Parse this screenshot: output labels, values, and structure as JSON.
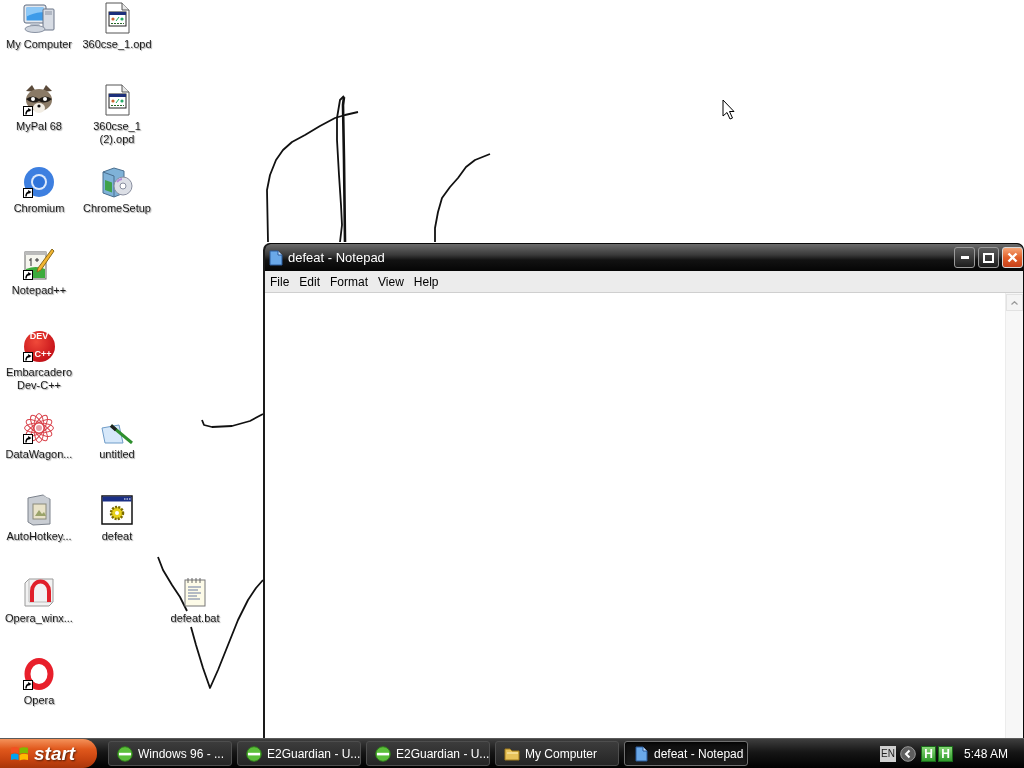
{
  "desktop": {
    "icons": [
      {
        "label": "My Computer",
        "kind": "computer",
        "shortcut": false
      },
      {
        "label": "360cse_1.opd",
        "kind": "opd",
        "shortcut": false
      },
      {
        "label": "MyPal 68",
        "kind": "raccoon",
        "shortcut": true
      },
      {
        "label": "360cse_1 (2).opd",
        "kind": "opd",
        "shortcut": false
      },
      {
        "label": "Chromium",
        "kind": "chromium",
        "shortcut": true
      },
      {
        "label": "ChromeSetup",
        "kind": "setup",
        "shortcut": false
      },
      {
        "label": "Notepad++",
        "kind": "notepadpp",
        "shortcut": true
      },
      {
        "label": "Embarcadero Dev-C++",
        "kind": "devcpp",
        "shortcut": true,
        "logo_text": [
          "DEV",
          "C++"
        ]
      },
      {
        "label": "DataWagon...",
        "kind": "datawagon",
        "shortcut": true
      },
      {
        "label": "untitled",
        "kind": "image",
        "shortcut": false
      },
      {
        "label": "AutoHotkey...",
        "kind": "installer",
        "shortcut": false
      },
      {
        "label": "defeat",
        "kind": "program",
        "shortcut": false
      },
      {
        "label": "Opera_winx...",
        "kind": "opera-installer",
        "shortcut": false
      },
      {
        "label": "defeat.bat",
        "kind": "batch",
        "shortcut": false
      },
      {
        "label": "Opera",
        "kind": "opera",
        "shortcut": true
      }
    ]
  },
  "window": {
    "title": "defeat - Notepad",
    "menu": [
      "File",
      "Edit",
      "Format",
      "View",
      "Help"
    ]
  },
  "taskbar": {
    "start": "start",
    "tasks": [
      {
        "label": "Windows 96 - ...",
        "kind": "browser",
        "selected": false
      },
      {
        "label": "E2Guardian - U...",
        "kind": "browser",
        "selected": false
      },
      {
        "label": "E2Guardian - U...",
        "kind": "browser",
        "selected": false
      },
      {
        "label": "My Computer",
        "kind": "folder",
        "selected": false
      },
      {
        "label": "defeat - Notepad",
        "kind": "notepad",
        "selected": true
      }
    ],
    "tray": {
      "language": "EN",
      "indicators": [
        "H",
        "H"
      ],
      "clock": "5:48 AM"
    }
  }
}
